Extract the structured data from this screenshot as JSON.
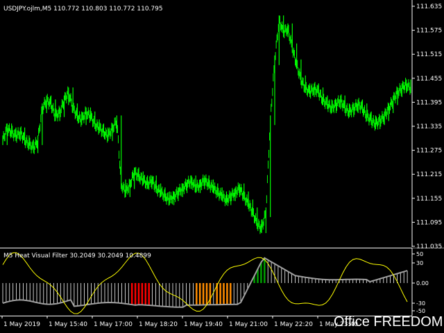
{
  "header": {
    "symbol_info": "USDJPY.ojlm,M5  110.772 110.803 110.772 110.795"
  },
  "indicator_header": "M5 Heat Visual Filter 30.2049 30.2049 10.4899",
  "watermark": "Office FREEDOM",
  "colors": {
    "background": "#000000",
    "candle": "#00ff00",
    "separator": "#ffffff",
    "indicator_yellow": "#ffff00",
    "indicator_gray": "#a0a0a0",
    "histogram_white": "#ffffff",
    "histogram_red": "#ff0000",
    "histogram_orange": "#ff8c00",
    "histogram_green": "#00a000"
  },
  "price_axis": {
    "labels": [
      "111.635",
      "111.575",
      "111.515",
      "111.455",
      "111.395",
      "111.335",
      "111.275",
      "111.215",
      "111.155",
      "111.095",
      "111.035"
    ]
  },
  "indicator_axis": {
    "labels": [
      "50",
      "30",
      "0.00",
      "-30",
      "-50"
    ]
  },
  "time_axis": {
    "labels": [
      "1 May 2019",
      "1 May 15:40",
      "1 May 17:00",
      "1 May 18:20",
      "1 May 19:40",
      "1 May 21:00",
      "1 May 22:20",
      "1 May 23:40"
    ]
  },
  "chart_data": {
    "type": "line",
    "title": "USDJPY.ojlm,M5",
    "close_series": [
      111.3,
      111.33,
      111.32,
      111.31,
      111.32,
      111.3,
      111.29,
      111.28,
      111.3,
      111.38,
      111.4,
      111.39,
      111.36,
      111.37,
      111.4,
      111.42,
      111.38,
      111.36,
      111.35,
      111.37,
      111.36,
      111.34,
      111.33,
      111.32,
      111.31,
      111.33,
      111.35,
      111.19,
      111.17,
      111.19,
      111.22,
      111.21,
      111.2,
      111.19,
      111.2,
      111.18,
      111.17,
      111.16,
      111.15,
      111.16,
      111.17,
      111.18,
      111.19,
      111.2,
      111.18,
      111.19,
      111.2,
      111.19,
      111.18,
      111.17,
      111.16,
      111.15,
      111.16,
      111.17,
      111.18,
      111.16,
      111.14,
      111.12,
      111.09,
      111.08,
      111.12,
      111.35,
      111.5,
      111.6,
      111.57,
      111.58,
      111.53,
      111.49,
      111.45,
      111.43,
      111.42,
      111.43,
      111.42,
      111.4,
      111.39,
      111.38,
      111.39,
      111.4,
      111.38,
      111.37,
      111.38,
      111.39,
      111.38,
      111.36,
      111.35,
      111.34,
      111.35,
      111.36,
      111.38,
      111.4,
      111.42,
      111.43,
      111.44,
      111.43
    ],
    "indicator": {
      "name": "M5 Heat Visual Filter",
      "values": [
        30.2049,
        30.2049,
        10.4899
      ],
      "levels": [
        50,
        30,
        0,
        -30,
        -50
      ]
    }
  }
}
